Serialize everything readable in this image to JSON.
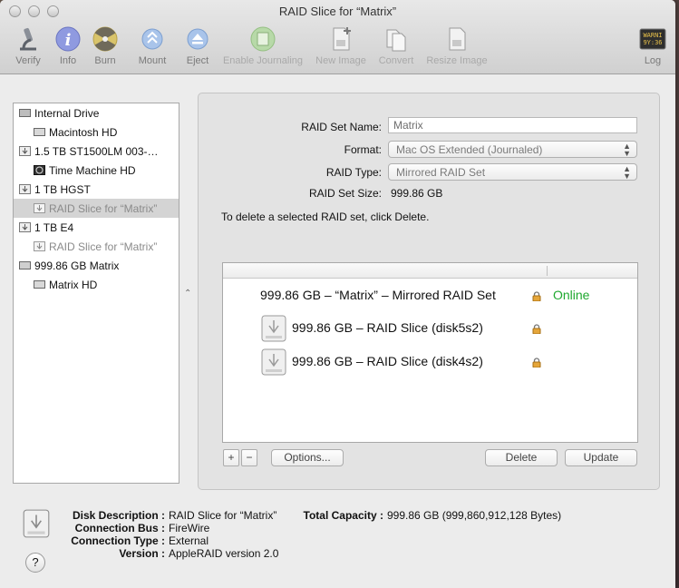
{
  "window": {
    "title": "RAID Slice for “Matrix”"
  },
  "toolbar": {
    "verify": "Verify",
    "info": "Info",
    "burn": "Burn",
    "mount": "Mount",
    "eject": "Eject",
    "enable_journaling": "Enable Journaling",
    "new_image": "New Image",
    "convert": "Convert",
    "resize_image": "Resize Image",
    "log": "Log",
    "log_icon_text": "WARNI\n9Y:36"
  },
  "sidebar": {
    "items": [
      {
        "label": "Internal Drive",
        "icon": "internal-drive-icon"
      },
      {
        "label": "Macintosh HD",
        "icon": "volume-icon"
      },
      {
        "label": "1.5 TB ST1500LM 003-…",
        "icon": "usb-drive-icon"
      },
      {
        "label": "Time Machine HD",
        "icon": "time-machine-icon"
      },
      {
        "label": "1 TB HGST",
        "icon": "usb-drive-icon"
      },
      {
        "label": "RAID Slice for “Matrix”",
        "icon": "raid-slice-icon"
      },
      {
        "label": "1 TB E4",
        "icon": "usb-drive-icon"
      },
      {
        "label": "RAID Slice for “Matrix”",
        "icon": "raid-slice-icon"
      },
      {
        "label": "999.86 GB Matrix",
        "icon": "raid-drive-icon"
      },
      {
        "label": "Matrix HD",
        "icon": "volume-icon"
      }
    ]
  },
  "raid": {
    "name_label": "RAID Set Name:",
    "name_value": "Matrix",
    "format_label": "Format:",
    "format_value": "Mac OS Extended (Journaled)",
    "type_label": "RAID Type:",
    "type_value": "Mirrored RAID Set",
    "size_label": "RAID Set Size:",
    "size_value": "999.86 GB",
    "instructions": "To delete a selected RAID set, click Delete.",
    "rows": [
      {
        "label": "999.86 GB – “Matrix” – Mirrored RAID Set",
        "status": "Online"
      },
      {
        "label": "999.86 GB – RAID Slice (disk5s2)"
      },
      {
        "label": "999.86 GB – RAID Slice (disk4s2)"
      }
    ],
    "add": "+",
    "remove": "−",
    "options": "Options...",
    "delete": "Delete",
    "update": "Update"
  },
  "info": {
    "disk_description_label": "Disk Description :",
    "disk_description": "RAID Slice for “Matrix”",
    "connection_bus_label": "Connection Bus :",
    "connection_bus": "FireWire",
    "connection_type_label": "Connection Type :",
    "connection_type": "External",
    "version_label": "Version :",
    "version": "AppleRAID version 2.0",
    "total_capacity_label": "Total Capacity :",
    "total_capacity": "999.86 GB (999,860,912,128 Bytes)",
    "help": "?"
  },
  "colors": {
    "online": "#1fa82f",
    "selection": "#d4d4d4"
  }
}
